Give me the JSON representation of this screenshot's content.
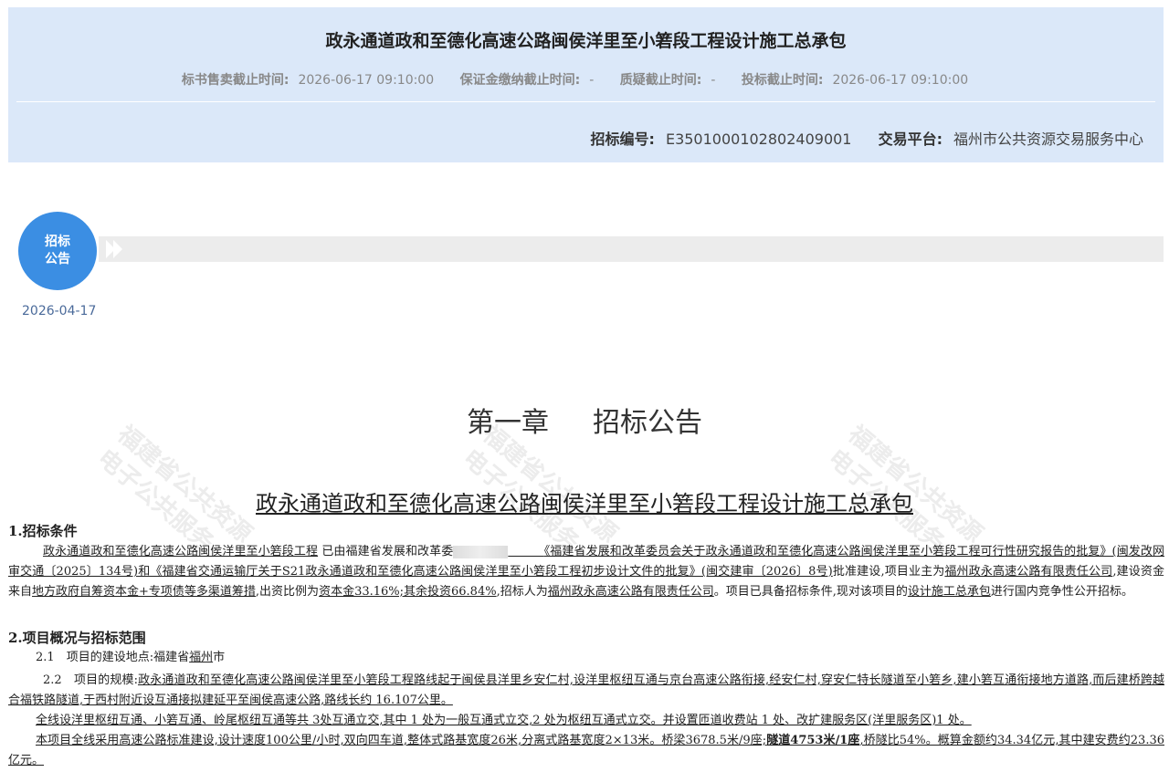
{
  "header": {
    "title": "政永通道政和至德化高速公路闽侯洋里至小箬段工程设计施工总承包",
    "deadlines": [
      {
        "label": "标书售卖截止时间:",
        "value": "2026-06-17 09:10:00"
      },
      {
        "label": "保证金缴纳截止时间:",
        "value": "-"
      },
      {
        "label": "质疑截止时间:",
        "value": "-"
      },
      {
        "label": "投标截止时间:",
        "value": "2026-06-17 09:10:00"
      }
    ],
    "bid_no_label": "招标编号:",
    "bid_no": "E3501000102802409001",
    "platform_label": "交易平台:",
    "platform": "福州市公共资源交易服务中心"
  },
  "timeline": {
    "node_label_line1": "招标",
    "node_label_line2": "公告",
    "date": "2026-04-17"
  },
  "watermark": {
    "line1": "福建省公共资源",
    "line2": "电子公共服务"
  },
  "doc": {
    "chapter_no": "第一章",
    "chapter_title": "招标公告",
    "title": "政永通道政和至德化高速公路闽侯洋里至小箬段工程设计施工总承包",
    "s1_heading": "1.招标条件",
    "s1_project": "政永通道政和至德化高速公路闽侯洋里至小箬段工程",
    "s1_t1": "已由福建省发展和改革委",
    "s1_t2": "《福建省发展和改革委员会关于政永通道政和至德化高速公路闽侯洋里至小箬段工程可行性研究报告的批复》(闽发改网审交通〔2025〕134号)和《福建省交通运输厅关于S21政永通道政和至德化高速公路闽侯洋里至小箬段工程初步设计文件的批复》(闽交建审〔2026〕8号)",
    "s1_t3": "批准建设,项目业主为",
    "s1_owner": "福州政永高速公路有限责任公司",
    "s1_t4": ",建设资金来自",
    "s1_funds": "地方政府自筹资本金+专项债等多渠道筹措",
    "s1_t5": ",出资比例为",
    "s1_ratio": "资本金33.16%;其余投资66.84%",
    "s1_t6": ",招标人为",
    "s1_tenderer": "福州政永高速公路有限责任公司",
    "s1_t7": "。项目已具备招标条件,现对该项目的",
    "s1_scope": "设计施工总承包",
    "s1_t8": "进行国内竞争性公开招标。",
    "s2_heading": "2.项目概况与招标范围",
    "s21_no": "2.1",
    "s21_label": "项目的建设地点:福建省",
    "s21_city": "福州",
    "s21_suffix": "市",
    "s22_no": "2.2",
    "s22_label": "项目的规模:",
    "s22_text": "政永通道政和至德化高速公路闽侯洋里至小箬段工程路线起于闽侯县洋里乡安仁村,设洋里枢纽互通与京台高速公路衔接,经安仁村,穿安仁特长隧道至小箬乡,建小箬互通衔接地方道路,而后建桥跨越合福铁路隧道,于西村附近设互通接拟建延平至闽侯高速公路,路线长约 16.107公里。",
    "s22_text2": "全线设洋里枢纽互通、小箬互通、岭尾枢纽互通等共 3处互通立交,其中 1 处为一般互通式立交,2 处为枢纽互通式立交。并设置匝道收费站 1 处、改扩建服务区(洋里服务区)1 处。",
    "s22_text3a": "本项目全线采用高速公路标准建设,设计速度100公里/小时,双向四车道,整体式路基宽度26米,分离式路基宽度2×13米。桥梁3678.5米/9座;",
    "s22_text3b": "隧道4753米/1座",
    "s22_text3c": ",桥隧比54%。概算金额约34.34亿元,其中建安费约23.36亿元。"
  }
}
